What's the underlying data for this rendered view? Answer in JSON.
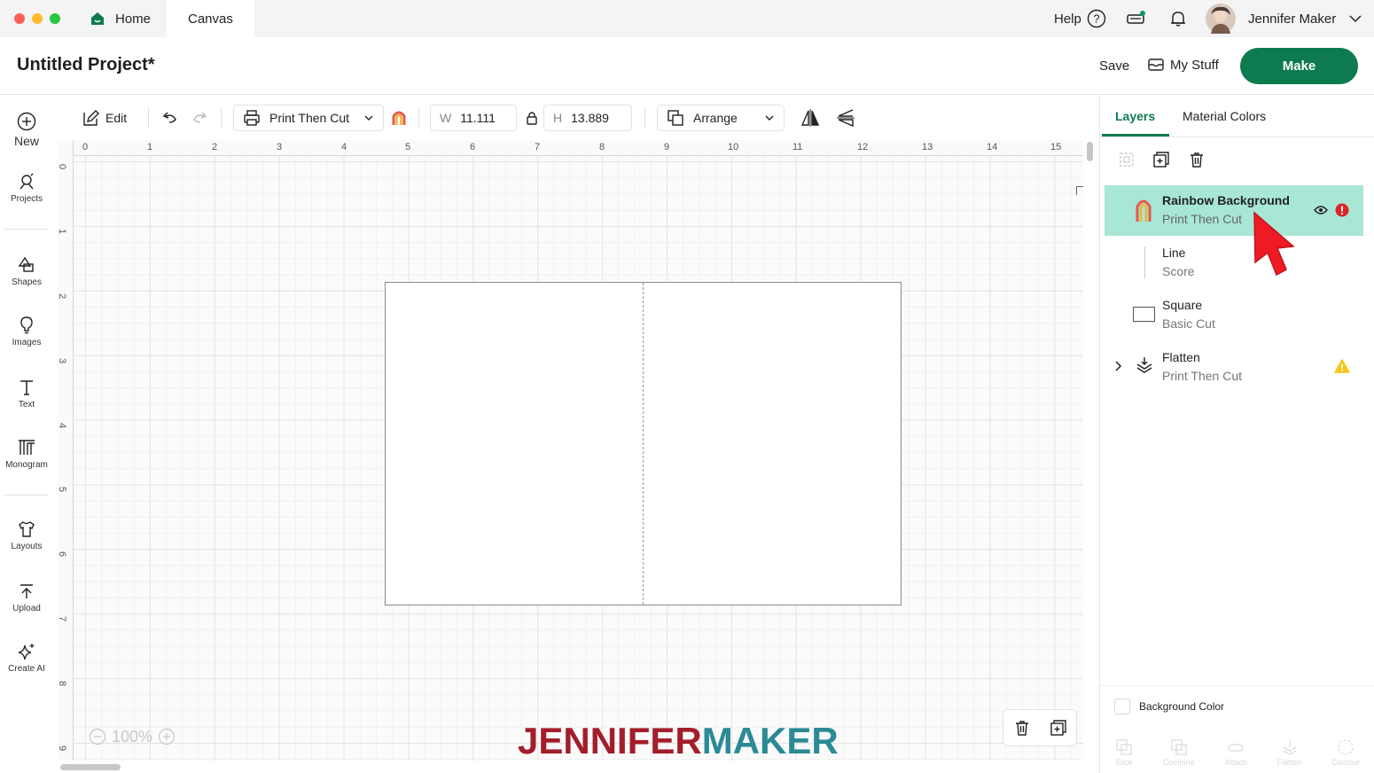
{
  "window": {
    "tabs": [
      {
        "label": "Home"
      },
      {
        "label": "Canvas"
      }
    ],
    "help_label": "Help",
    "user_name": "Jennifer Maker"
  },
  "project": {
    "title": "Untitled Project*",
    "save_label": "Save",
    "mystuff_label": "My Stuff",
    "make_label": "Make"
  },
  "sidebar": {
    "items": [
      {
        "label": "New",
        "icon": "plus-circle-icon"
      },
      {
        "label": "Projects",
        "icon": "projects-icon"
      },
      {
        "label": "Shapes",
        "icon": "shapes-icon"
      },
      {
        "label": "Images",
        "icon": "lightbulb-icon"
      },
      {
        "label": "Text",
        "icon": "text-icon"
      },
      {
        "label": "Monogram",
        "icon": "monogram-icon"
      },
      {
        "label": "Layouts",
        "icon": "shirt-icon"
      },
      {
        "label": "Upload",
        "icon": "upload-icon"
      },
      {
        "label": "Create AI",
        "icon": "sparkle-icon"
      }
    ]
  },
  "toolbar": {
    "edit_label": "Edit",
    "operation_label": "Print Then Cut",
    "width_label": "W",
    "width_value": "11.111",
    "height_label": "H",
    "height_value": "13.889",
    "arrange_label": "Arrange"
  },
  "rulers": {
    "top": [
      "0",
      "1",
      "2",
      "3",
      "4",
      "5",
      "6",
      "7",
      "8",
      "9",
      "10",
      "11",
      "12",
      "13",
      "14",
      "15"
    ],
    "left": [
      "0",
      "1",
      "2",
      "3",
      "4",
      "5",
      "6",
      "7",
      "8",
      "9"
    ]
  },
  "canvas": {
    "zoom_label": "100%",
    "watermark_part1": "JENNIFER",
    "watermark_part2": "MAKER"
  },
  "right_panel": {
    "tabs": [
      {
        "label": "Layers"
      },
      {
        "label": "Material Colors"
      }
    ],
    "layers": [
      {
        "name": "Rainbow Background",
        "type": "Print Then Cut",
        "selected": true,
        "status": "error"
      },
      {
        "name": "Line",
        "type": "Score"
      },
      {
        "name": "Square",
        "type": "Basic Cut"
      },
      {
        "name": "Flatten",
        "type": "Print Then Cut",
        "status": "warning"
      }
    ],
    "background_color_label": "Background Color",
    "bottom_tools": [
      {
        "label": "Slice"
      },
      {
        "label": "Combine"
      },
      {
        "label": "Attach"
      },
      {
        "label": "Flatten"
      },
      {
        "label": "Contour"
      }
    ]
  },
  "colors": {
    "brand_green": "#0e7a4f",
    "selected_layer": "#a8e6d6",
    "error_red": "#e02424",
    "warning_yellow": "#f5c518",
    "watermark_red": "#a31d2b",
    "watermark_teal": "#2b8a96"
  }
}
